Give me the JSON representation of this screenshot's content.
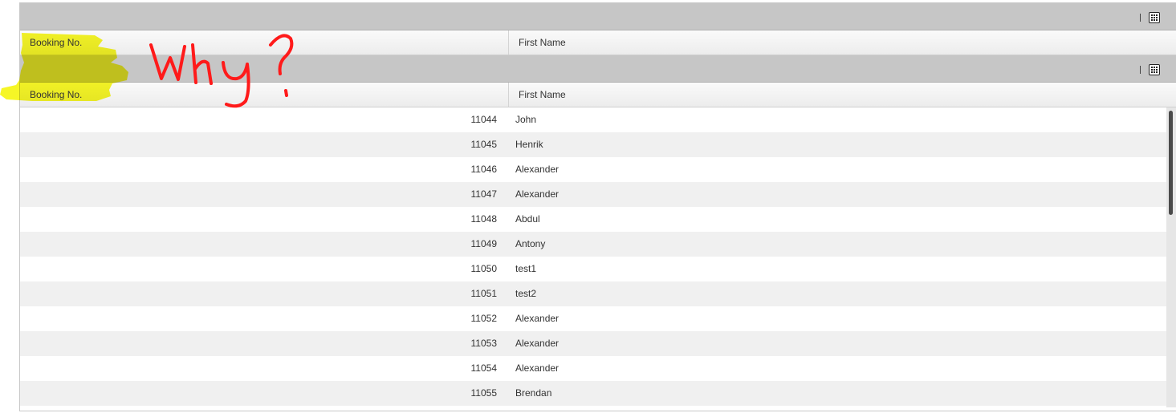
{
  "grids": [
    {
      "columns": [
        "Booking No.",
        "First Name"
      ]
    },
    {
      "columns": [
        "Booking No.",
        "First Name"
      ],
      "rows": [
        {
          "booking_no": "11044",
          "first_name": "John"
        },
        {
          "booking_no": "11045",
          "first_name": "Henrik"
        },
        {
          "booking_no": "11046",
          "first_name": "Alexander"
        },
        {
          "booking_no": "11047",
          "first_name": "Alexander"
        },
        {
          "booking_no": "11048",
          "first_name": "Abdul"
        },
        {
          "booking_no": "11049",
          "first_name": "Antony"
        },
        {
          "booking_no": "11050",
          "first_name": "test1"
        },
        {
          "booking_no": "11051",
          "first_name": "test2"
        },
        {
          "booking_no": "11052",
          "first_name": "Alexander"
        },
        {
          "booking_no": "11053",
          "first_name": "Alexander"
        },
        {
          "booking_no": "11054",
          "first_name": "Alexander"
        },
        {
          "booking_no": "11055",
          "first_name": "Brendan"
        }
      ]
    }
  ],
  "icons": {
    "toolbar_icon": "table-grid-icon"
  },
  "annotation": {
    "handwritten_text": "Why?",
    "highlight_color": "#ffff00",
    "ink_color": "#ff0000"
  }
}
